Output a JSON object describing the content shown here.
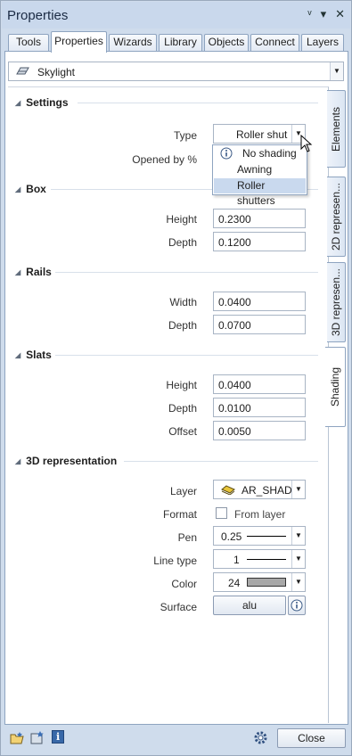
{
  "window": {
    "title": "Properties",
    "pin_glyph": "📌",
    "dropdown_glyph": "▾",
    "close_glyph": "✕"
  },
  "tabs": [
    "Tools",
    "Properties",
    "Wizards",
    "Library",
    "Objects",
    "Connect",
    "Layers"
  ],
  "active_tab": "Properties",
  "element_selector": {
    "value": "Skylight"
  },
  "side_tabs": [
    "Elements",
    "2D represen...",
    "3D represen...",
    "Shading"
  ],
  "settings": {
    "heading": "Settings",
    "type_label": "Type",
    "type_value": "Roller shut",
    "opened_by_label": "Opened by %",
    "type_options": [
      "No shading",
      "Awning",
      "Roller shutters"
    ],
    "type_selected": "Roller shutters"
  },
  "box": {
    "heading": "Box",
    "height_label": "Height",
    "height": "0.2300",
    "depth_label": "Depth",
    "depth": "0.1200"
  },
  "rails": {
    "heading": "Rails",
    "width_label": "Width",
    "width": "0.0400",
    "depth_label": "Depth",
    "depth": "0.0700"
  },
  "slats": {
    "heading": "Slats",
    "height_label": "Height",
    "height": "0.0400",
    "depth_label": "Depth",
    "depth": "0.0100",
    "offset_label": "Offset",
    "offset": "0.0050"
  },
  "repr3d": {
    "heading": "3D representation",
    "layer_label": "Layer",
    "layer": "AR_SHAD",
    "format_label": "Format",
    "format_checkbox": "From layer",
    "format_checked": false,
    "pen_label": "Pen",
    "pen": "0.25",
    "linetype_label": "Line type",
    "linetype": "1",
    "color_label": "Color",
    "color": "24",
    "color_swatch": "#a8a8a8",
    "surface_label": "Surface",
    "surface": "alu"
  },
  "footer": {
    "close_label": "Close"
  }
}
